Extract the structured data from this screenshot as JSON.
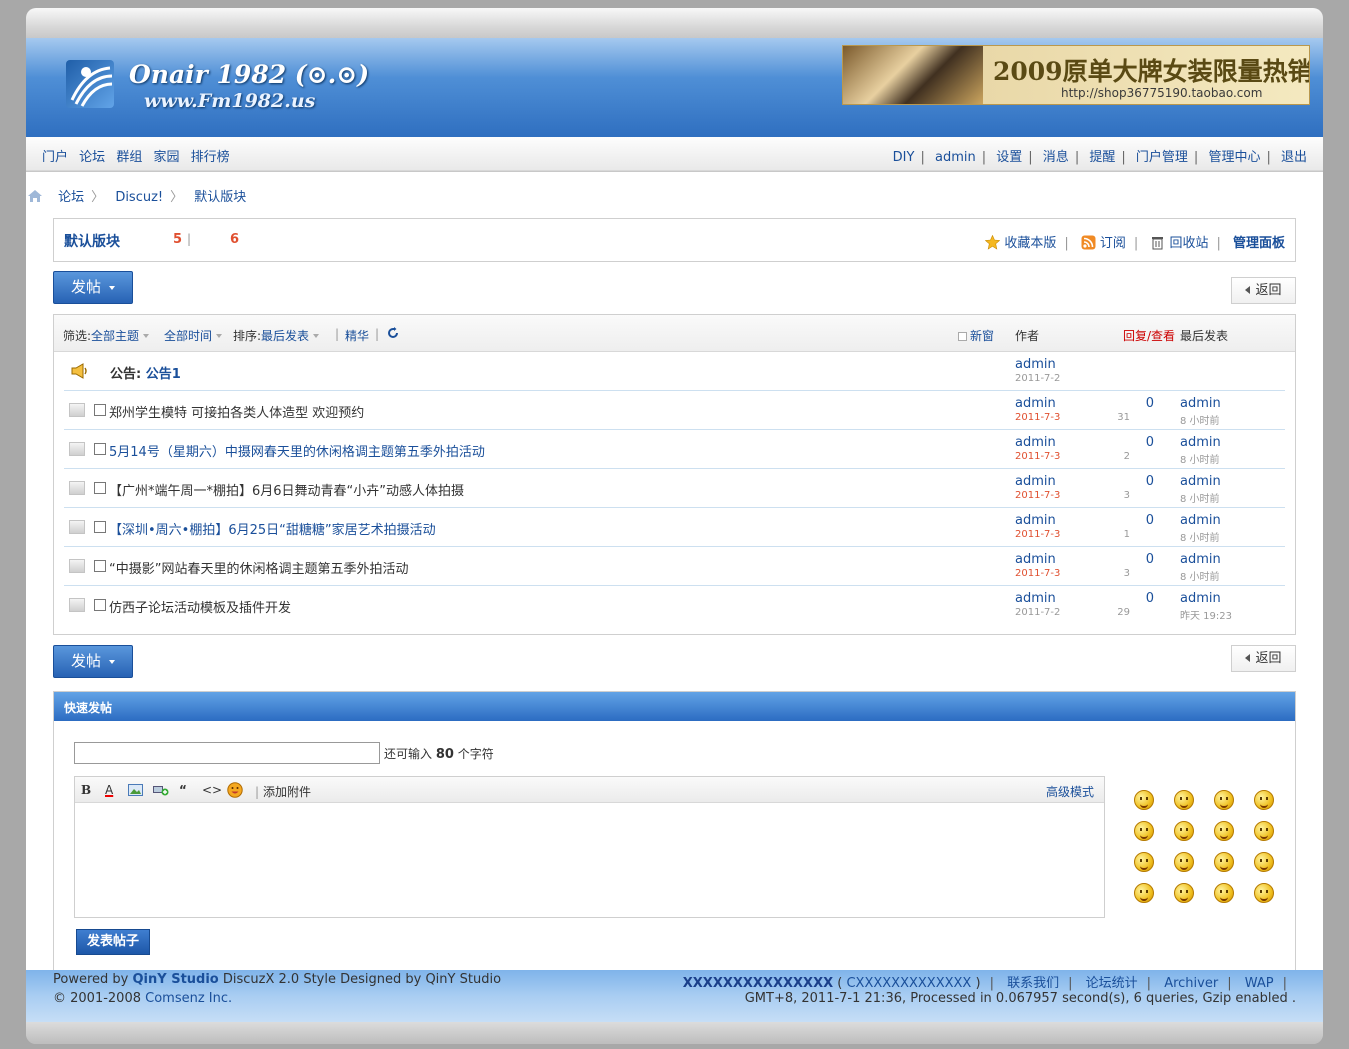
{
  "header": {
    "logo_title": "Onair 1982 (⊙.⊙)",
    "logo_url": "www.Fm1982.us",
    "banner_big": "2009原单大牌女装限量热销",
    "banner_small": "http://shop36775190.taobao.com"
  },
  "nav": {
    "left": [
      "门户",
      "论坛",
      "群组",
      "家园",
      "排行榜"
    ],
    "right": [
      "DIY",
      "admin",
      "设置",
      "消息",
      "提醒",
      "门户管理",
      "管理中心",
      "退出"
    ]
  },
  "breadcrumb": [
    "论坛",
    "Discuz!",
    "默认版块"
  ],
  "forum": {
    "name": "默认版块",
    "today": "5",
    "total": "6",
    "fav": "收藏本版",
    "rss": "订阅",
    "recycle": "回收站",
    "manage": "管理面板"
  },
  "buttons": {
    "post": "发帖",
    "back": "返回"
  },
  "filter": {
    "label": "筛选:",
    "all_topics": "全部主题",
    "all_time": "全部时间",
    "sort_label": "排序:",
    "sort_value": "最后发表",
    "digest": "精华",
    "new_window": "新窗",
    "col_author": "作者",
    "col_reply": "回复/查看",
    "col_last": "最后发表"
  },
  "announcement": {
    "label": "公告:",
    "title": "公告1",
    "author": "admin",
    "date": "2011-7-2"
  },
  "threads": [
    {
      "title": "郑州学生模特 可接拍各类人体造型 欢迎预约",
      "author": "admin",
      "date": "2011-7-3",
      "date_red": true,
      "replies": "0",
      "views": "31",
      "last_user": "admin",
      "last_time": "8 小时前",
      "title_color": "#333333"
    },
    {
      "title": "5月14号（星期六）中摄网春天里的休闲格调主题第五季外拍活动",
      "author": "admin",
      "date": "2011-7-3",
      "date_red": true,
      "replies": "0",
      "views": "2",
      "last_user": "admin",
      "last_time": "8 小时前",
      "title_color": "#1a4f9a"
    },
    {
      "title": "【广州*端午周一*棚拍】6月6日舞动青春“小卉”动感人体拍摄",
      "author": "admin",
      "date": "2011-7-3",
      "date_red": true,
      "replies": "0",
      "views": "3",
      "last_user": "admin",
      "last_time": "8 小时前",
      "title_color": "#333333"
    },
    {
      "title": "【深圳•周六•棚拍】6月25日“甜糖糖”家居艺术拍摄活动",
      "author": "admin",
      "date": "2011-7-3",
      "date_red": true,
      "replies": "0",
      "views": "1",
      "last_user": "admin",
      "last_time": "8 小时前",
      "title_color": "#1a4f9a"
    },
    {
      "title": "“中摄影”网站春天里的休闲格调主题第五季外拍活动",
      "author": "admin",
      "date": "2011-7-3",
      "date_red": true,
      "replies": "0",
      "views": "3",
      "last_user": "admin",
      "last_time": "8 小时前",
      "title_color": "#333333"
    },
    {
      "title": "仿西子论坛活动模板及插件开发",
      "author": "admin",
      "date": "2011-7-2",
      "date_red": false,
      "replies": "0",
      "views": "29",
      "last_user": "admin",
      "last_time": "昨天 19:23",
      "title_color": "#333333"
    }
  ],
  "quick": {
    "header": "快速发帖",
    "hint_pre": "还可输入",
    "hint_num": "80",
    "hint_post": "个字符",
    "toolbar": {
      "bold": "B",
      "color": "A",
      "quote": "“",
      "code": "<>",
      "attach": "添加附件",
      "advanced": "高级模式"
    },
    "submit": "发表帖子"
  },
  "footer": {
    "powered_pre": "Powered by",
    "powered_brand": "QinY Studio",
    "powered_post": "DiscuzX 2.0 Style Designed by QinY Studio",
    "copyright_pre": "© 2001-2008",
    "copyright_link": "Comsenz Inc.",
    "site_name": "XXXXXXXXXXXXXXX",
    "site_code": "CXXXXXXXXXXXXX",
    "links": [
      "联系我们",
      "论坛统计",
      "Archiver",
      "WAP"
    ],
    "stats": "GMT+8, 2011-7-1 21:36, Processed in 0.067957 second(s), 6 queries, Gzip enabled ."
  },
  "colors": {
    "accent": "#1a4f9a",
    "header_blue": "#2f6fc0",
    "red": "#e05030"
  }
}
